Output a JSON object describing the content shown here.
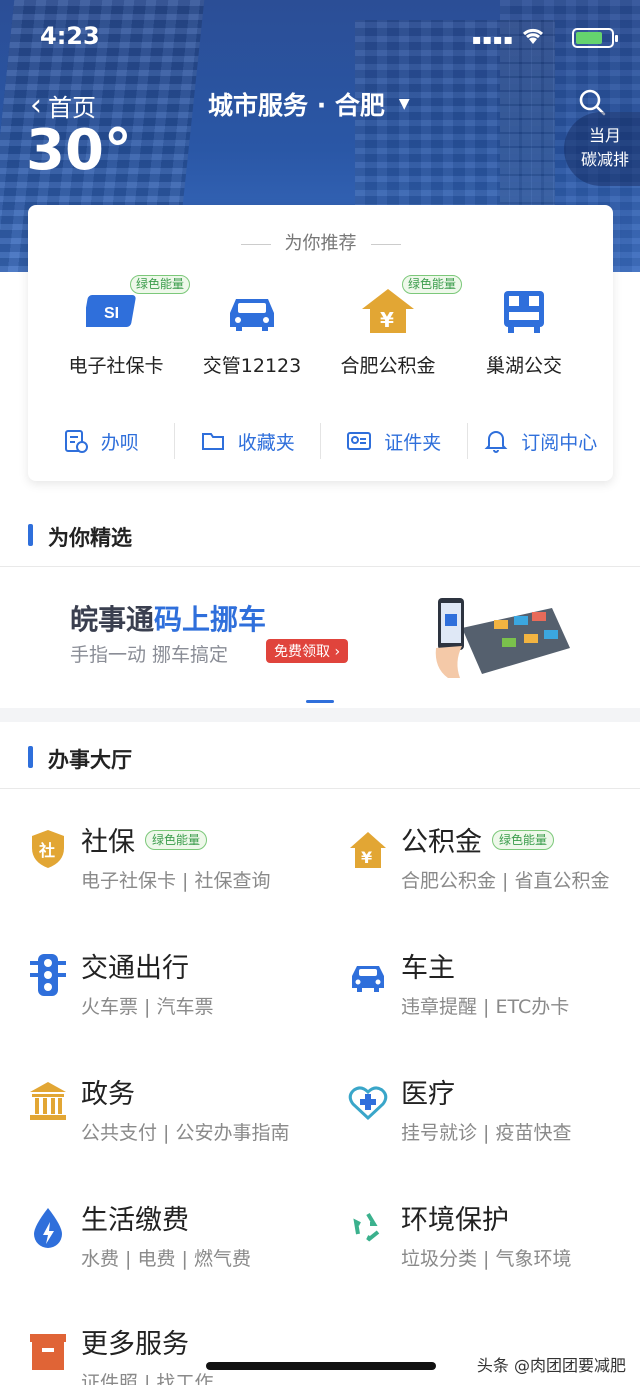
{
  "status_bar": {
    "time": "4:23",
    "signal": "▪▪▪▪",
    "wifi": "wifi-icon",
    "battery": "charging"
  },
  "header": {
    "back_label": "首页",
    "title": "城市服务 · 合肥",
    "temperature": "30°",
    "carbon_line1": "当月",
    "carbon_line2": "碳减排"
  },
  "recommend": {
    "heading": "为你推荐",
    "items": [
      {
        "label": "电子社保卡",
        "icon": "social-security-card-icon",
        "badge": "绿色能量",
        "color": "#2f6fdb"
      },
      {
        "label": "交管12123",
        "icon": "car-icon",
        "badge": "",
        "color": "#2f6fdb"
      },
      {
        "label": "合肥公积金",
        "icon": "housing-fund-icon",
        "badge": "绿色能量",
        "color": "#e2a634"
      },
      {
        "label": "巢湖公交",
        "icon": "bus-qr-icon",
        "badge": "",
        "color": "#2f6fdb"
      }
    ],
    "tools": [
      {
        "label": "办呗",
        "icon": "task-icon"
      },
      {
        "label": "收藏夹",
        "icon": "folder-icon"
      },
      {
        "label": "证件夹",
        "icon": "id-card-icon"
      },
      {
        "label": "订阅中心",
        "icon": "bell-icon"
      }
    ]
  },
  "featured": {
    "title": "为你精选",
    "banner_title_a": "皖事通",
    "banner_title_b": "码上挪车",
    "banner_subtitle": "手指一动 挪车搞定",
    "banner_pill": "免费领取 ›"
  },
  "hall": {
    "title": "办事大厅",
    "services": [
      {
        "name": "社保",
        "badge": "绿色能量",
        "desc": "电子社保卡 | 社保查询",
        "icon": "shield-icon"
      },
      {
        "name": "公积金",
        "badge": "绿色能量",
        "desc": "合肥公积金 | 省直公积金",
        "icon": "housing-fund-icon"
      },
      {
        "name": "交通出行",
        "badge": "",
        "desc": "火车票 | 汽车票",
        "icon": "traffic-light-icon"
      },
      {
        "name": "车主",
        "badge": "",
        "desc": "违章提醒 | ETC办卡",
        "icon": "car-icon"
      },
      {
        "name": "政务",
        "badge": "",
        "desc": "公共支付 | 公安办事指南",
        "icon": "government-building-icon"
      },
      {
        "name": "医疗",
        "badge": "",
        "desc": "挂号就诊 | 疫苗快查",
        "icon": "medical-heart-icon"
      },
      {
        "name": "生活缴费",
        "badge": "",
        "desc": "水费 | 电费 | 燃气费",
        "icon": "water-drop-icon"
      },
      {
        "name": "环境保护",
        "badge": "",
        "desc": "垃圾分类 | 气象环境",
        "icon": "recycle-icon"
      },
      {
        "name": "更多服务",
        "badge": "",
        "desc": "证件照 | 找工作",
        "icon": "box-icon"
      }
    ]
  },
  "watermark": "头条 @肉团团要减肥"
}
